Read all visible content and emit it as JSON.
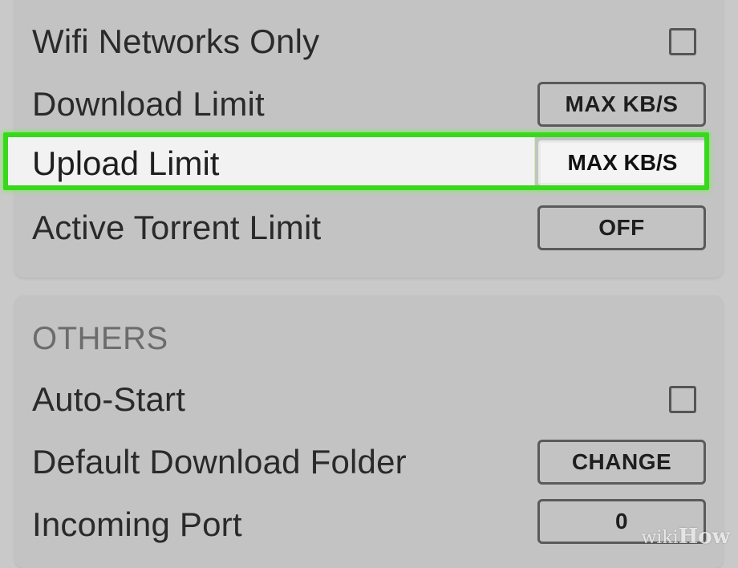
{
  "network": {
    "wifi_only": {
      "label": "Wifi Networks Only",
      "checked": false
    },
    "download_limit": {
      "label": "Download Limit",
      "value": "MAX KB/S"
    },
    "upload_limit": {
      "label": "Upload Limit",
      "value": "MAX KB/S"
    },
    "active_torrent_limit": {
      "label": "Active Torrent Limit",
      "value": "OFF"
    }
  },
  "others": {
    "header": "OTHERS",
    "auto_start": {
      "label": "Auto-Start",
      "checked": false
    },
    "default_download_folder": {
      "label": "Default Download Folder",
      "button": "CHANGE"
    },
    "incoming_port": {
      "label": "Incoming Port",
      "value": "0"
    }
  },
  "colors": {
    "background": "#c9c9c9",
    "highlight_frame": "#38d81c",
    "highlight_fill": "#f2f2f2"
  },
  "watermark": {
    "prefix": "wiki",
    "suffix": "How"
  }
}
